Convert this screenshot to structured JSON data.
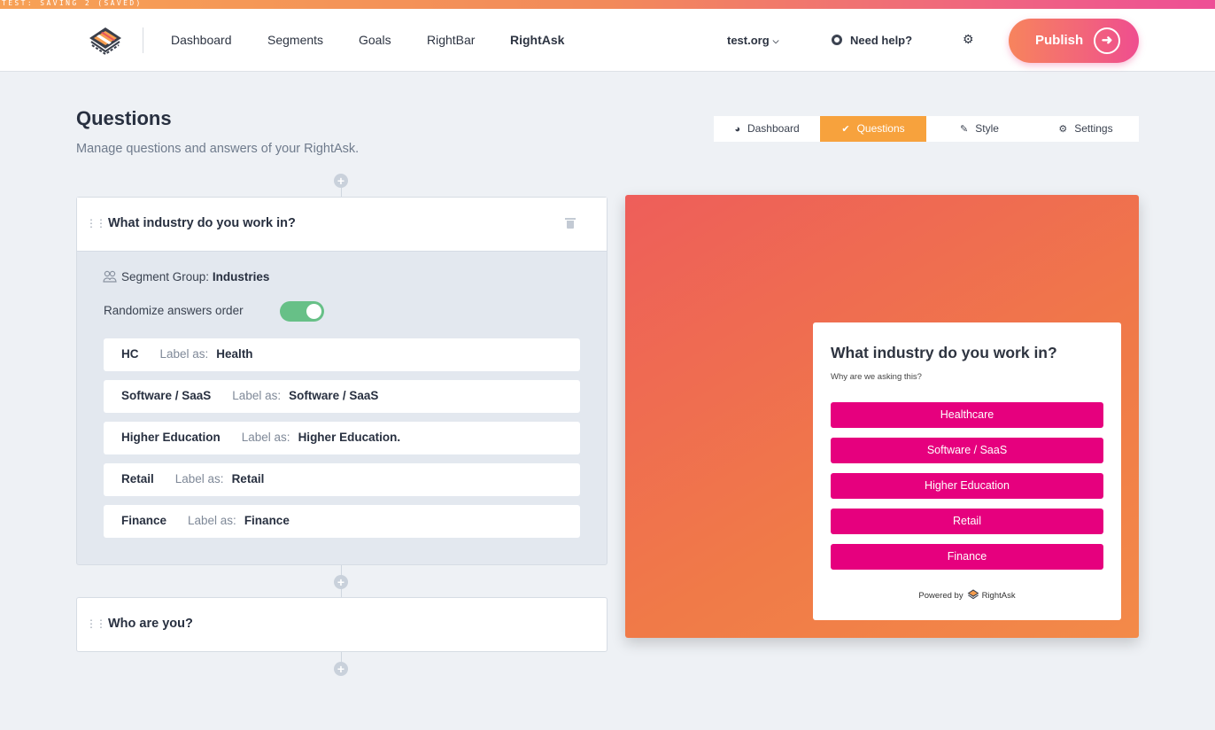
{
  "status_strip": "TEST: SAVING 2 (SAVED)",
  "nav": {
    "items": [
      {
        "label": "Dashboard"
      },
      {
        "label": "Segments"
      },
      {
        "label": "Goals"
      },
      {
        "label": "RightBar"
      },
      {
        "label": "RightAsk",
        "active": true
      }
    ],
    "org": "test.org",
    "help": "Need help?",
    "publish": "Publish"
  },
  "page": {
    "title": "Questions",
    "subtitle": "Manage questions and answers of your RightAsk."
  },
  "tabs": [
    {
      "label": "Dashboard",
      "icon": "gauge-icon"
    },
    {
      "label": "Questions",
      "icon": "check-icon",
      "active": true
    },
    {
      "label": "Style",
      "icon": "brush-icon"
    },
    {
      "label": "Settings",
      "icon": "gear-icon"
    }
  ],
  "questions": [
    {
      "title": "What industry do you work in?",
      "segment_group_label": "Segment Group:",
      "segment_group": "Industries",
      "randomize_label": "Randomize answers order",
      "randomize": true,
      "label_as_text": "Label as:",
      "answers": [
        {
          "code": "HC",
          "label": "Health"
        },
        {
          "code": "Software / SaaS",
          "label": "Software / SaaS"
        },
        {
          "code": "Higher Education",
          "label": "Higher Education."
        },
        {
          "code": "Retail",
          "label": "Retail"
        },
        {
          "code": "Finance",
          "label": "Finance"
        }
      ]
    },
    {
      "title": "Who are you?"
    }
  ],
  "preview": {
    "title": "What industry do you work in?",
    "why": "Why are we asking this?",
    "buttons": [
      "Healthcare",
      "Software / SaaS",
      "Higher Education",
      "Retail",
      "Finance"
    ],
    "powered_by": "Powered by",
    "brand": "RightAsk",
    "button_color": "#e6007e"
  },
  "colors": {
    "accent_orange": "#f7a23d",
    "toggle_green": "#67c087",
    "publish_gradient": [
      "#f7845d",
      "#ef4e8f"
    ]
  }
}
